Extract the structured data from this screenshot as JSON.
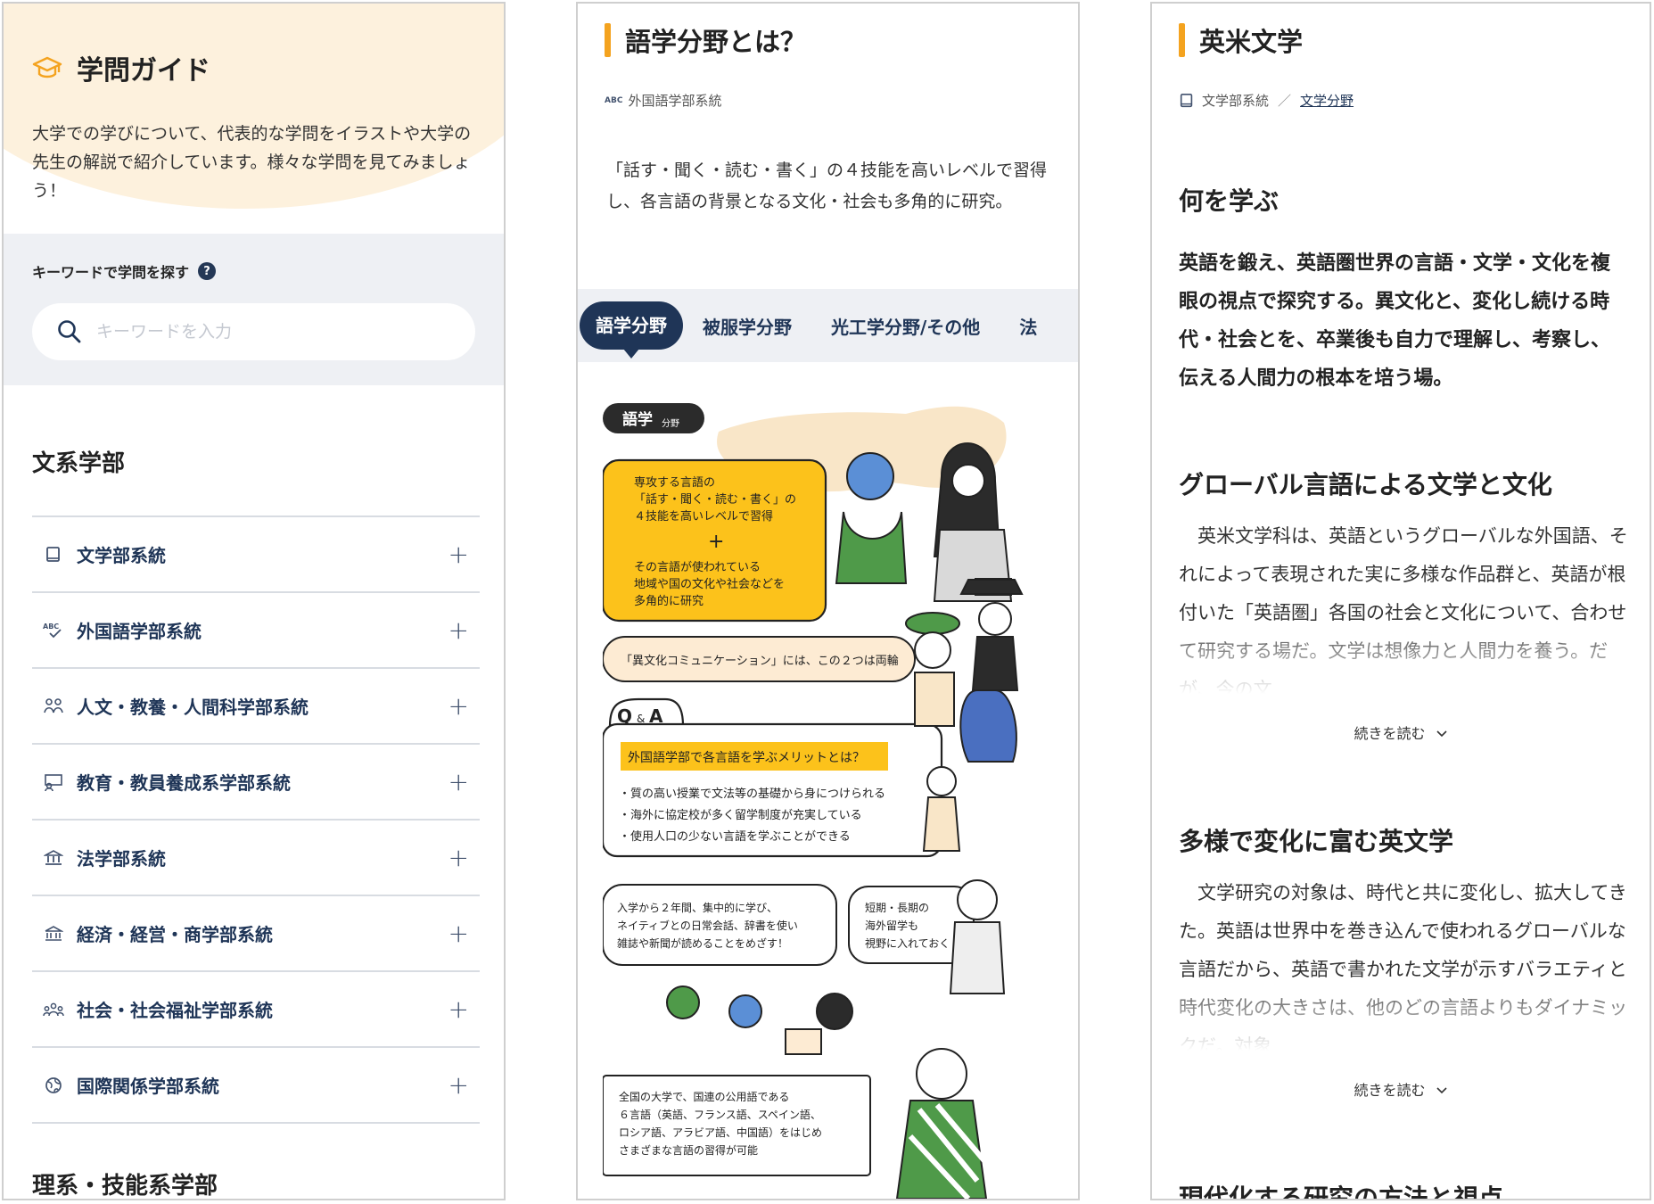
{
  "guide": {
    "title": "学問ガイド",
    "intro": "大学での学びについて、代表的な学問をイラストや大学の先生の解説で紹介しています。様々な学問を見てみましょう！",
    "search_label": "キーワードで学問を探す",
    "search_help": "?",
    "search_placeholder": "キーワードを入力",
    "humanities_heading": "文系学部",
    "science_heading": "理系・技能系学部",
    "expand_symbol": "+",
    "faculties": [
      {
        "label": "文学部系統",
        "icon": "book-icon"
      },
      {
        "label": "外国語学部系統",
        "icon": "abc-check-icon"
      },
      {
        "label": "人文・教養・人間科学部系統",
        "icon": "people-icon"
      },
      {
        "label": "教育・教員養成系学部系統",
        "icon": "teacher-icon"
      },
      {
        "label": "法学部系統",
        "icon": "court-icon"
      },
      {
        "label": "経済・経営・商学部系統",
        "icon": "bank-icon"
      },
      {
        "label": "社会・社会福祉学部系統",
        "icon": "community-icon"
      },
      {
        "label": "国際関係学部系統",
        "icon": "globe-icon"
      }
    ]
  },
  "linguistics": {
    "title": "語学分野とは？",
    "category_icon_text": "ABC",
    "category": "外国語学部系統",
    "description": "「話す・聞く・読む・書く」の４技能を高いレベルで習得し、各言語の背景となる文化・社会も多角的に研究。",
    "tabs": [
      "語学分野",
      "被服学分野",
      "光工学分野/その他",
      "法"
    ],
    "illustration": {
      "badge_main": "語学",
      "badge_sub": "分野",
      "box1_lines": [
        "専攻する言語の",
        "「話す・聞く・読む・書く」の",
        "４技能を高いレベルで習得"
      ],
      "box1_plus": "+",
      "box1_lines2": [
        "その言語が使われている",
        "地域や国の文化や社会などを",
        "多角的に研究"
      ],
      "pill": "「異文化コミュニケーション」には、この２つは両輪",
      "qa_q": "Q",
      "qa_amp": "&",
      "qa_a": "A",
      "qa_question": "外国語学部で各言語を学ぶメリットとは？",
      "qa_points": [
        "・質の高い授業で文法等の基礎から身につけられる",
        "・海外に協定校が多く留学制度が充実している",
        "・使用人口の少ない言語を学ぶことができる"
      ],
      "bubble_left": [
        "入学から２年間、集中的に学び、",
        "ネイティブとの日常会話、辞書を使い",
        "雑誌や新聞が読めることをめざす！"
      ],
      "bubble_right": [
        "短期・長期の",
        "海外留学も",
        "視野に入れておく"
      ],
      "bottom_box": [
        "全国の大学で、国連の公用語である",
        "６言語（英語、フランス語、スペイン語、",
        "ロシア語、アラビア語、中国語）をはじめ",
        "さまざまな言語の習得が可能"
      ]
    }
  },
  "literature": {
    "title": "英米文学",
    "crumb_parent": "文学部系統",
    "crumb_sep": "／",
    "crumb_link": "文学分野",
    "what_heading": "何を学ぶ",
    "what_lead": "英語を鍛え、英語圏世界の言語・文学・文化を複眼の視点で探究する。異文化と、変化し続ける時代・社会とを、卒業後も自力で理解し、考察し、伝える人間力の根本を培う場。",
    "sec1_heading": "グローバル言語による文学と文化",
    "sec1_body": "英米文学科は、英語というグローバルな外国語、それによって表現された実に多様な作品群と、英語が根付いた「英語圏」各国の社会と文化について、合わせて研究する場だ。文学は想像力と人間力を養う。だが、今の文",
    "sec2_heading": "多様で変化に富む英文学",
    "sec2_body": "文学研究の対象は、時代と共に変化し、拡大してきた。英語は世界中を巻き込んで使われるグローバルな言語だから、英語で書かれた文学が示すバラエティと時代変化の大きさは、他のどの言語よりもダイナミックだ。対象",
    "read_more": "続きを読む",
    "sec3_heading": "現代化する研究の方法と視点"
  },
  "colors": {
    "navy": "#1f3557",
    "accent_orange": "#f4a31f",
    "highlight_yellow": "#fcc21b",
    "cream": "#fdf1dd",
    "panel_gray": "#eef0f4"
  }
}
